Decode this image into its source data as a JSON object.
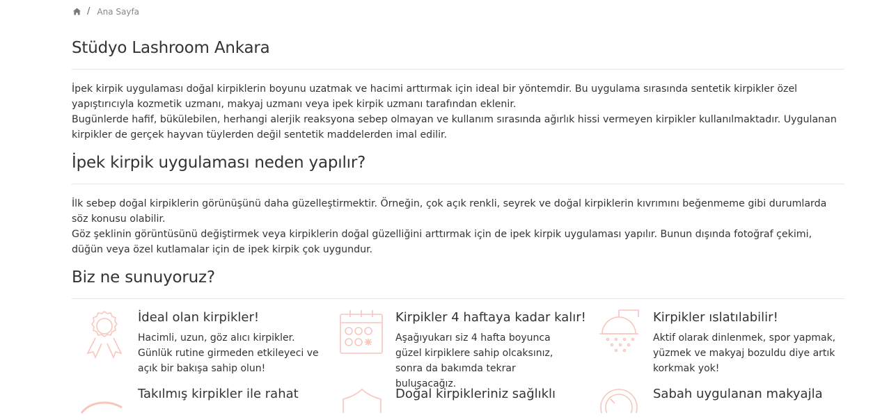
{
  "breadcrumb": {
    "home_icon": "home-icon",
    "separator": "/",
    "current": "Ana Sayfa"
  },
  "page_title": "Stüdyo Lashroom Ankara",
  "intro": {
    "p1": "İpek kirpik uygulaması doğal kirpiklerin boyunu uzatmak ve hacimi arttırmak için ideal bir yöntemdir. Bu uygulama sırasında sentetik kirpikler özel yapıştırıcıyla kozmetik uzmanı, makyaj uzmanı veya ipek kirpik uzmanı tarafından eklenir.",
    "p2": "Bugünlerde hafif, bükülebilen, herhangi alerjik reaksyona sebep olmayan ve kullanım sırasında ağırlık hissi vermeyen kirpikler kullanılmaktadır. Uygulanan kirpikler de gerçek hayvan tüylerden değil sentetik maddelerden imal edilir."
  },
  "why": {
    "heading": "İpek kirpik uygulaması neden yapılır?",
    "p1": "İlk sebep doğal kirpiklerin görünüşünü daha güzelleştirmektir. Örneğin, çok açık renkli, seyrek ve doğal kirpiklerin kıvrımını beğenmeme gibi durumlarda söz konusu olabilir.",
    "p2": "Göz şeklinin görüntüsünü değiştirmek veya kirpiklerin doğal güzelliğini arttırmak için de ipek kirpik uygulaması yapılır. Bunun dışında fotoğraf çekimi, düğün veya özel kutlamalar için de ipek kirpik çok uygundur."
  },
  "offer": {
    "heading": "Biz ne sunuyoruz?",
    "features": [
      {
        "icon": "award-ribbon-icon",
        "title": "İdeal olan kirpikler!",
        "desc": "Hacimli, uzun, göz alıcı kirpikler. Günlük rutine girmeden etkileyeci ve açık bir bakışa sahip olun!"
      },
      {
        "icon": "calendar-icon",
        "title": "Kirpikler 4 haftaya kadar kalır!",
        "desc": "Aşağıyukarı siz 4 hafta boyunca güzel kirpiklere sahip olcaksınız, sonra da bakımda tekrar buluşacağız."
      },
      {
        "icon": "shower-icon",
        "title": "Kirpikler ıslatılabilir!",
        "desc": "Aktif olarak dinlenmek, spor yapmak, yüzmek ve makyaj bozuldu diye artık korkmak yok!"
      },
      {
        "icon": "eye-icon",
        "title": "Takılmış kirpikler ile rahat",
        "desc": ""
      },
      {
        "icon": "shield-icon",
        "title": "Doğal kirpikleriniz sağlıklı",
        "desc": ""
      },
      {
        "icon": "clock-icon",
        "title": "Sabah uygulanan makyajla",
        "desc": ""
      }
    ]
  },
  "colors": {
    "accent": "#f7c6bd",
    "text": "#333333",
    "rule": "#e6e6e6"
  }
}
